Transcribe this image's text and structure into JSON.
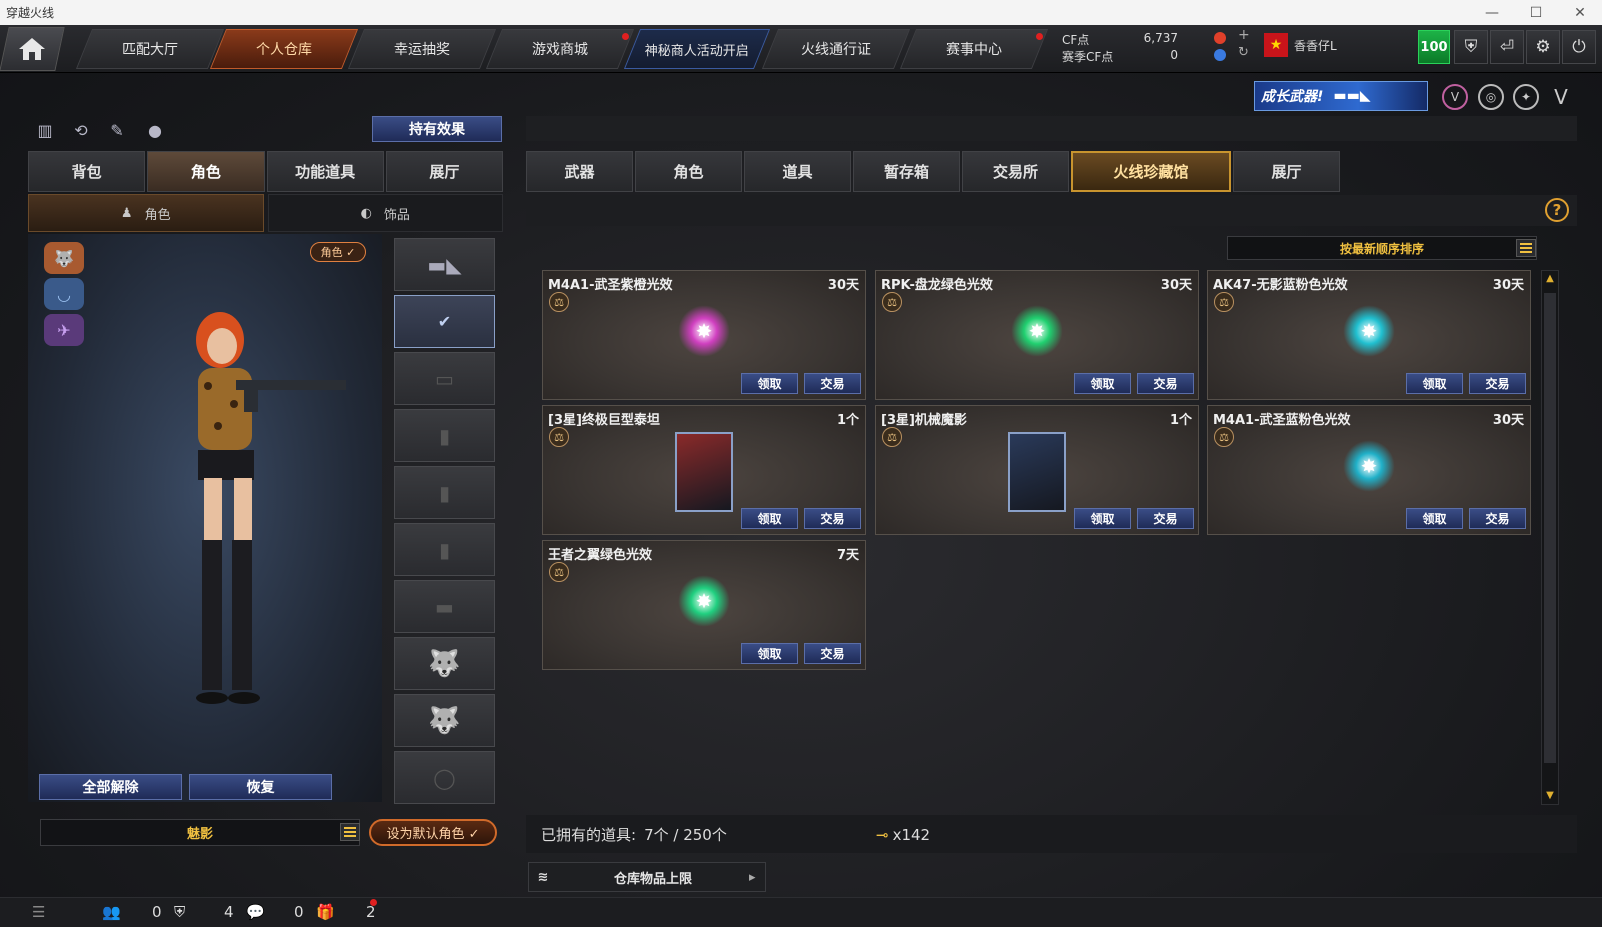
{
  "window": {
    "title": "穿越火线"
  },
  "nav": {
    "tabs": [
      {
        "label": "匹配大厅"
      },
      {
        "label": "个人仓库"
      },
      {
        "label": "幸运抽奖"
      },
      {
        "label": "游戏商城"
      },
      {
        "label": "神秘商人活动开启"
      },
      {
        "label": "火线通行证"
      },
      {
        "label": "赛事中心"
      }
    ],
    "cf_label": "CF点",
    "cf_value": "6,737",
    "season_cf_label": "赛季CF点",
    "season_cf_value": "0",
    "username": "香香仔L",
    "level": "100"
  },
  "banner": {
    "text": "成长武器!"
  },
  "left": {
    "hold_effect_label": "持有效果",
    "tabs": [
      {
        "label": "背包"
      },
      {
        "label": "角色"
      },
      {
        "label": "功能道具"
      },
      {
        "label": "展厅"
      }
    ],
    "subtabs": [
      {
        "label": "角色"
      },
      {
        "label": "饰品"
      }
    ],
    "role_badge": "角色 ✓",
    "release_all_label": "全部解除",
    "restore_label": "恢复",
    "character_name": "魅影",
    "set_default_label": "设为默认角色 ✓"
  },
  "right": {
    "tabs": [
      {
        "label": "武器"
      },
      {
        "label": "角色"
      },
      {
        "label": "道具"
      },
      {
        "label": "暂存箱"
      },
      {
        "label": "交易所"
      },
      {
        "label": "火线珍藏馆"
      },
      {
        "label": "展厅"
      }
    ],
    "sort_label": "按最新顺序排序",
    "items": [
      {
        "name": "M4A1-武圣紫橙光效",
        "duration": "30天",
        "kind": "glow",
        "color": "#d040c0",
        "claim": "领取",
        "trade": "交易"
      },
      {
        "name": "RPK-盘龙绿色光效",
        "duration": "30天",
        "kind": "glow",
        "color": "#20d070",
        "claim": "领取",
        "trade": "交易"
      },
      {
        "name": "AK47-无影蓝粉色光效",
        "duration": "30天",
        "kind": "glow",
        "color": "#20c0d0",
        "claim": "领取",
        "trade": "交易"
      },
      {
        "name": "[3星]终极巨型泰坦",
        "duration": "1个",
        "kind": "portrait",
        "color": "#8a2a2a",
        "claim": "领取",
        "trade": "交易"
      },
      {
        "name": "[3星]机械魔影",
        "duration": "1个",
        "kind": "portrait",
        "color": "#2a3a5a",
        "claim": "领取",
        "trade": "交易"
      },
      {
        "name": "M4A1-武圣蓝粉色光效",
        "duration": "30天",
        "kind": "glow",
        "color": "#20b0c8",
        "claim": "领取",
        "trade": "交易"
      },
      {
        "name": "王者之翼绿色光效",
        "duration": "7天",
        "kind": "glow",
        "color": "#20d080",
        "claim": "领取",
        "trade": "交易"
      }
    ],
    "owned_label": "已拥有的道具:",
    "owned_value": "7个 / 250个",
    "key_count": "x142",
    "limit_label": "仓库物品上限"
  },
  "status": {
    "friends_count": "0",
    "messages_count": "4",
    "gifts_count": "0",
    "notices_count": "2"
  },
  "colors": {
    "accent": "#c8942e",
    "button_blue": "#2a3a6a",
    "highlight_yellow": "#f0c040"
  }
}
